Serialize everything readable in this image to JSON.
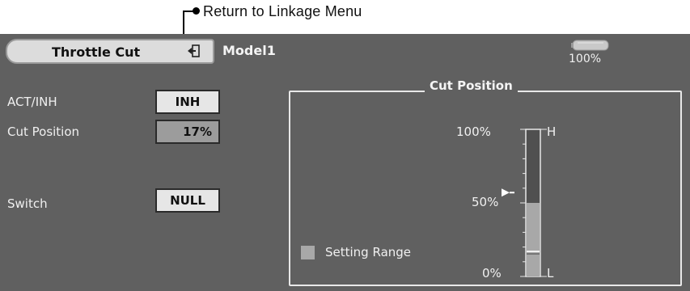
{
  "annotation": {
    "return_label": "Return to Linkage Menu"
  },
  "header": {
    "title": "Throttle Cut",
    "model": "Model1",
    "battery_percent": "100%"
  },
  "settings": {
    "act_inh_label": "ACT/INH",
    "act_inh_value": "INH",
    "cut_position_label": "Cut Position",
    "cut_position_value": "17%",
    "switch_label": "Switch",
    "switch_value": "NULL"
  },
  "gauge": {
    "title": "Cut Position",
    "label_100": "100%",
    "label_50": "50%",
    "label_0": "0%",
    "label_high": "H",
    "label_low": "L",
    "legend": "Setting Range",
    "cut_value": 17,
    "stick_value": 57,
    "range_min": 0,
    "range_max": 50,
    "colors": {
      "range": "#a8a8a8",
      "track": "#505050",
      "line": "#e8e8e8"
    }
  }
}
